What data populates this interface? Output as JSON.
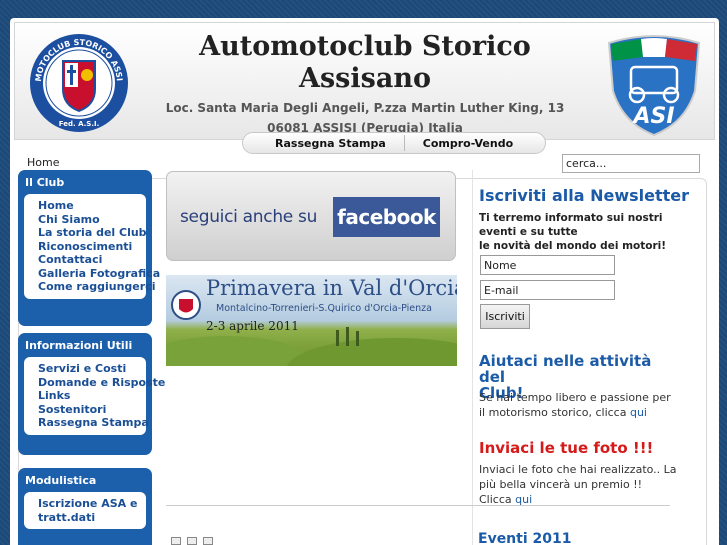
{
  "header": {
    "title_line1": "Automotoclub Storico",
    "title_line2": "Assisano",
    "address_line1": "Loc. Santa Maria Degli Angeli, P.zza Martin Luther King, 13",
    "address_line2": "06081 ASSISI (Perugia) Italia",
    "left_logo": {
      "ring_text": "AUTOMOTOCLUB STORICO ASSISANO",
      "bottom_text": "Fed. A.S.I."
    },
    "right_logo": {
      "text": "ASI"
    }
  },
  "topnav": [
    "Rassegna Stampa",
    "Compro-Vendo"
  ],
  "breadcrumb": "Home",
  "search": {
    "value": "cerca..."
  },
  "sidebar": {
    "modules": [
      {
        "title": "Il Club",
        "items": [
          "Home",
          "Chi Siamo",
          "La storia del Club",
          "Riconoscimenti",
          "Contattaci",
          "Galleria Fotografica",
          "Come raggiungerci"
        ]
      },
      {
        "title": "Informazioni Utili",
        "items": [
          "Servizi e Costi",
          "Domande e Risposte",
          "Links",
          "Sostenitori",
          "Rassegna Stampa"
        ]
      },
      {
        "title": "Modulistica",
        "items": [
          "Iscrizione ASA e",
          "tratt.dati"
        ]
      }
    ]
  },
  "main": {
    "facebook_banner": {
      "text": "seguici anche su",
      "logo": "facebook"
    },
    "event_banner": {
      "title": "Primavera in Val d'Orcia",
      "subtitle": "Montalcino-Torrenieri-S.Quirico d'Orcia-Pienza",
      "date": "2-3 aprile 2011"
    }
  },
  "right": {
    "newsletter": {
      "title": "Iscriviti alla Newsletter",
      "desc1": "Ti terremo informato sui nostri",
      "desc2": "eventi e su tutte",
      "desc3": "le novità del mondo dei motori!",
      "name_value": "Nome",
      "email_value": "E-mail",
      "button": "Iscriviti"
    },
    "help": {
      "title1": "Aiutaci nelle attività del",
      "title2": "Club!",
      "text": "Se hai tempo libero e passione per il motorismo storico, clicca ",
      "link": "qui"
    },
    "photos": {
      "title": "Inviaci le tue foto !!!",
      "text": "Inviaci le foto che hai realizzato.. La più bella vincerà un premio !!",
      "text2": "Clicca ",
      "link": "qui"
    },
    "events_title": "Eventi 2011"
  },
  "colors": {
    "module_blue": "#1c5fab",
    "heading_blue": "#1b5aa6",
    "alert_red": "#d51a1a"
  }
}
